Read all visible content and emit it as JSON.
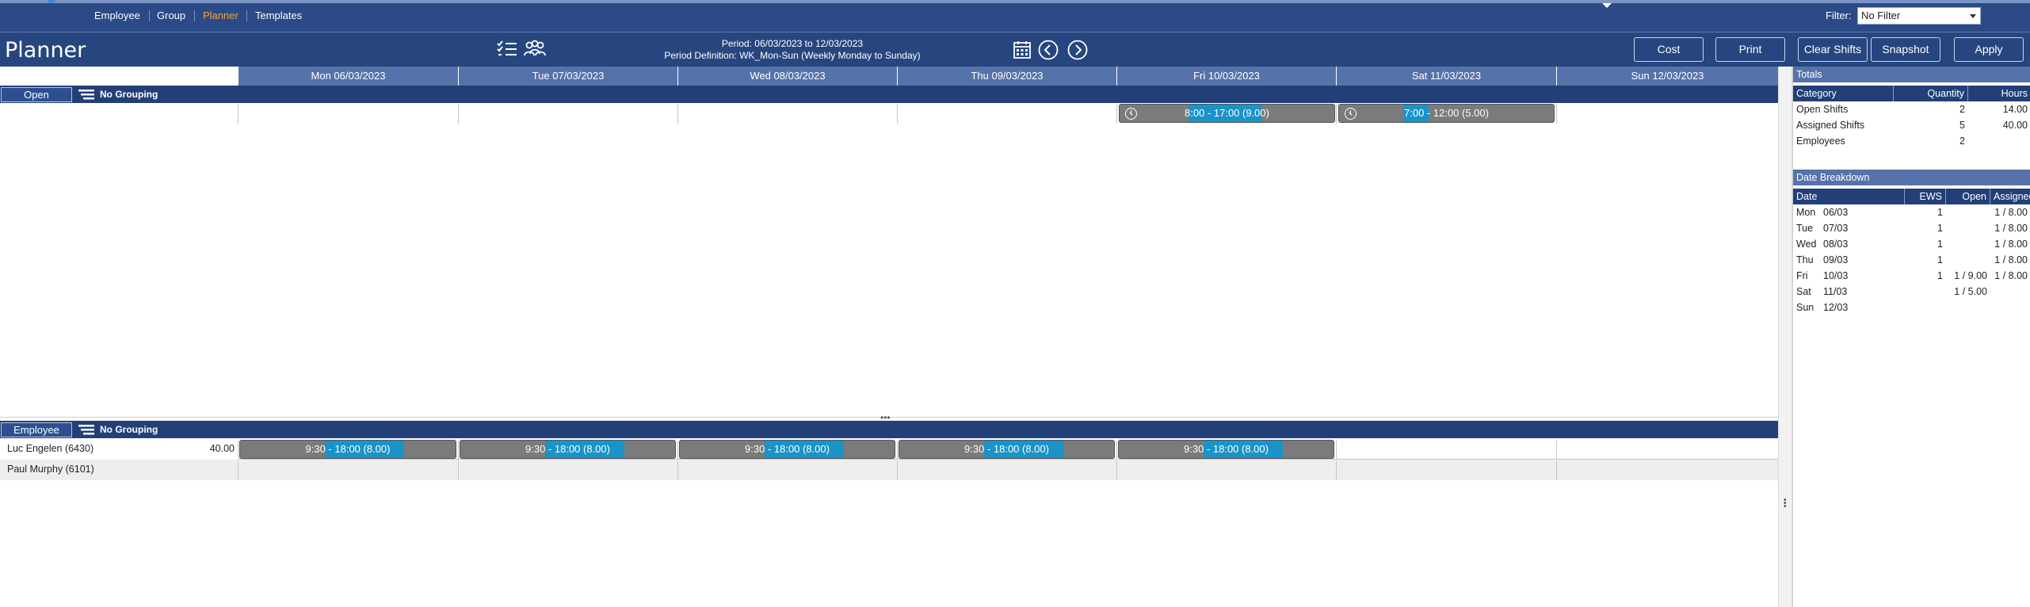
{
  "nav": {
    "items": [
      {
        "label": "Employee",
        "active": false
      },
      {
        "label": "Group",
        "active": false
      },
      {
        "label": "Planner",
        "active": true
      },
      {
        "label": "Templates",
        "active": false
      }
    ],
    "filter_label": "Filter:",
    "filter_value": "No Filter"
  },
  "toolbar": {
    "title": "Planner",
    "period_line": "Period: 06/03/2023 to 12/03/2023",
    "period_definition": "Period Definition: WK_Mon-Sun (Weekly Monday to Sunday)",
    "buttons": [
      "Cost",
      "Print",
      "Clear Shifts",
      "Snapshot",
      "Apply"
    ],
    "icons": [
      "checklist-icon",
      "team-icon",
      "calendar-icon",
      "previous-icon",
      "next-icon"
    ]
  },
  "days": [
    "Mon 06/03/2023",
    "Tue 07/03/2023",
    "Wed 08/03/2023",
    "Thu 09/03/2023",
    "Fri 10/03/2023",
    "Sat 11/03/2023",
    "Sun 12/03/2023"
  ],
  "open_section": {
    "button_label": "Open",
    "grouping_label": "No Grouping",
    "shifts": [
      {
        "day_index": 4,
        "label": "8:00 - 17:00 (9.00)"
      },
      {
        "day_index": 5,
        "label": "7:00 - 12:00 (5.00)"
      }
    ]
  },
  "employee_section": {
    "button_label": "Employee",
    "grouping_label": "No Grouping",
    "employees": [
      {
        "name": "Luc Engelen (6430)",
        "hours": "40.00",
        "shifts": [
          {
            "day_index": 0,
            "label": "9:30 - 18:00 (8.00)"
          },
          {
            "day_index": 1,
            "label": "9:30 - 18:00 (8.00)"
          },
          {
            "day_index": 2,
            "label": "9:30 - 18:00 (8.00)"
          },
          {
            "day_index": 3,
            "label": "9:30 - 18:00 (8.00)"
          },
          {
            "day_index": 4,
            "label": "9:30 - 18:00 (8.00)"
          }
        ]
      },
      {
        "name": "Paul Murphy (6101)",
        "hours": "",
        "shifts": []
      }
    ]
  },
  "totals": {
    "title": "Totals",
    "columns": [
      "Category",
      "Quantity",
      "Hours"
    ],
    "rows": [
      {
        "category": "Open Shifts",
        "quantity": "2",
        "hours": "14.00"
      },
      {
        "category": "Assigned Shifts",
        "quantity": "5",
        "hours": "40.00"
      },
      {
        "category": "Employees",
        "quantity": "2",
        "hours": ""
      }
    ]
  },
  "breakdown": {
    "title": "Date Breakdown",
    "columns": [
      "Date",
      "EWS",
      "Open",
      "Assigned"
    ],
    "rows": [
      {
        "day": "Mon",
        "date": "06/03",
        "ews": "1",
        "open": "",
        "assigned": "1 / 8.00"
      },
      {
        "day": "Tue",
        "date": "07/03",
        "ews": "1",
        "open": "",
        "assigned": "1 / 8.00"
      },
      {
        "day": "Wed",
        "date": "08/03",
        "ews": "1",
        "open": "",
        "assigned": "1 / 8.00"
      },
      {
        "day": "Thu",
        "date": "09/03",
        "ews": "1",
        "open": "",
        "assigned": "1 / 8.00"
      },
      {
        "day": "Fri",
        "date": "10/03",
        "ews": "1",
        "open": "1 / 9.00",
        "assigned": "1 / 8.00"
      },
      {
        "day": "Sat",
        "date": "11/03",
        "ews": "",
        "open": "1 / 5.00",
        "assigned": ""
      },
      {
        "day": "Sun",
        "date": "12/03",
        "ews": "",
        "open": "",
        "assigned": ""
      }
    ]
  },
  "colors": {
    "nav_bg": "#2b4a87",
    "header_bg": "#5672aa",
    "group_bar_bg": "#233f78",
    "shift_bg": "#7b7b7b",
    "shift_accent": "#1a93c8",
    "active_nav": "#f0a43a"
  }
}
